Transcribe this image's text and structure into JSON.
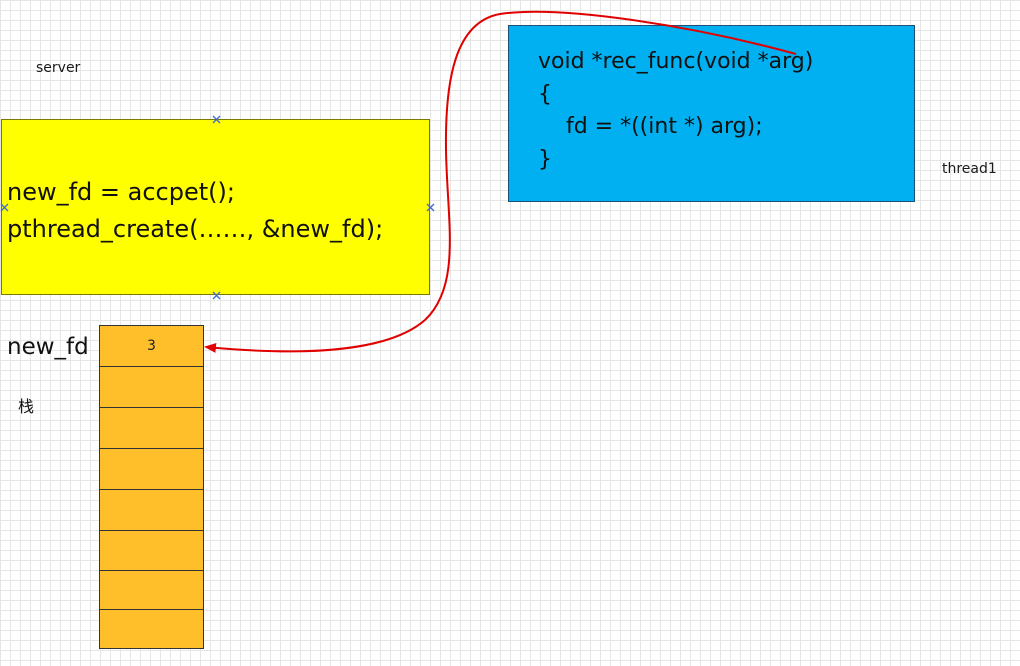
{
  "labels": {
    "server": "server",
    "thread": "thread1",
    "stack": "栈",
    "variable": "new_fd"
  },
  "server_code": [
    "new_fd = accpet();",
    "pthread_create(……, &new_fd);"
  ],
  "thread_code": [
    "void *rec_func(void *arg)",
    "{",
    "    fd = *((int *) arg);",
    "}"
  ],
  "stack_cells": [
    "3",
    "",
    "",
    "",
    "",
    "",
    "",
    ""
  ],
  "colors": {
    "server_box": "#ffff00",
    "thread_box": "#00b0f0",
    "stack_cell": "#ffbf2b",
    "arrow": "#e00000",
    "handle": "#3a6ad8"
  }
}
